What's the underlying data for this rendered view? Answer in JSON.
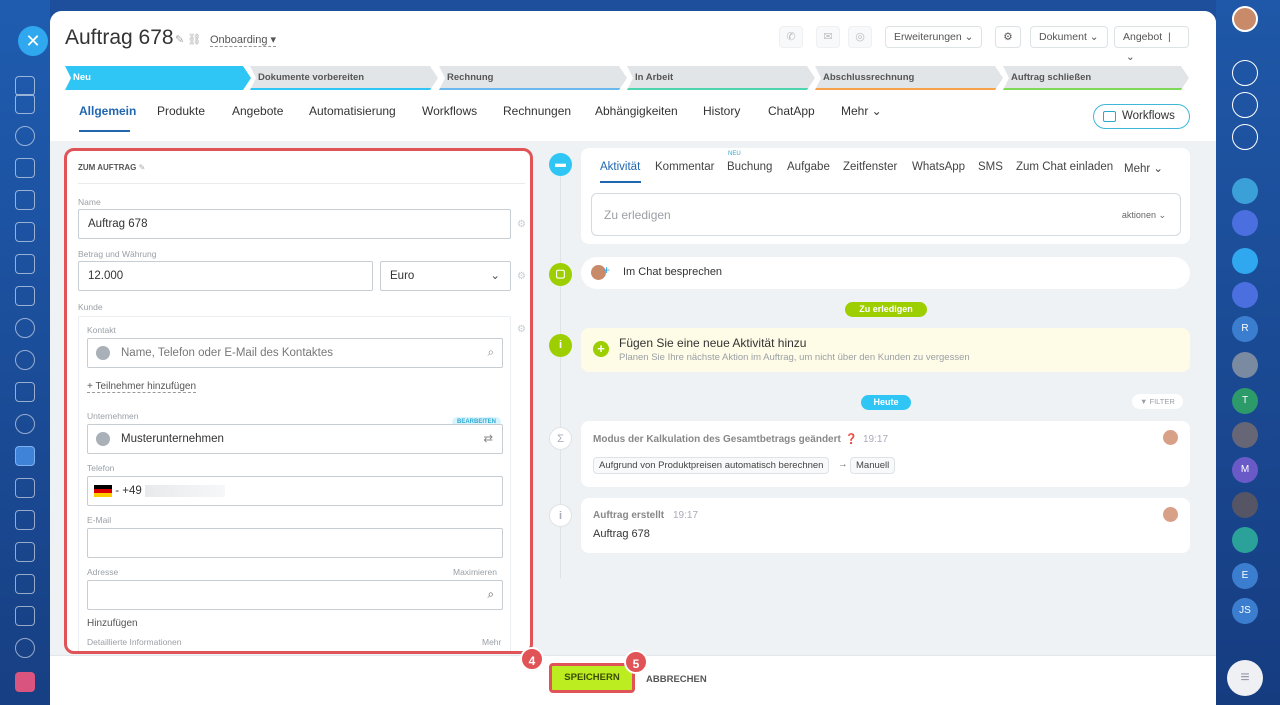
{
  "header": {
    "title": "Auftrag 678",
    "category": "Onboarding"
  },
  "top_buttons": {
    "extensions": "Erweiterungen",
    "document": "Dokument",
    "offer": "Angebot"
  },
  "stages": [
    "Neu",
    "Dokumente vorbereiten",
    "Rechnung",
    "In Arbeit",
    "Abschlussrechnung",
    "Auftrag schließen"
  ],
  "tabs": [
    "Allgemein",
    "Produkte",
    "Angebote",
    "Automatisierung",
    "Workflows",
    "Rechnungen",
    "Abhängigkeiten",
    "History",
    "ChatApp",
    "Mehr"
  ],
  "workflows_button": "Workflows",
  "form": {
    "section_title": "ZUM AUFTRAG",
    "name_label": "Name",
    "name_value": "Auftrag 678",
    "amount_label": "Betrag und Währung",
    "amount_value": "12.000",
    "currency_value": "Euro",
    "client_label": "Kunde",
    "contact_label": "Kontakt",
    "contact_placeholder": "Name, Telefon oder E-Mail des Kontaktes",
    "add_participant": "+ Teilnehmer hinzufügen",
    "company_label": "Unternehmen",
    "company_value": "Musterunternehmen",
    "edit_badge": "BEARBEITEN",
    "phone_label": "Telefon",
    "phone_prefix": "- +49",
    "email_label": "E-Mail",
    "address_label": "Adresse",
    "maximize": "Maximieren",
    "add": "Hinzufügen",
    "details_label": "Detaillierte Informationen",
    "more": "Mehr"
  },
  "activity": {
    "tabs": [
      "Aktivität",
      "Kommentar",
      "Buchung",
      "Aufgabe",
      "Zeitfenster",
      "WhatsApp",
      "SMS",
      "Zum Chat einladen",
      "Mehr"
    ],
    "new_badge": "NEU",
    "todo_placeholder": "Zu erledigen",
    "actions": "aktionen",
    "chat_discuss": "Im Chat besprechen",
    "todo_pill": "Zu erledigen",
    "add_activity_title": "Fügen Sie eine neue Aktivität hinzu",
    "add_activity_desc": "Planen Sie Ihre nächste Aktion im Auftrag, um nicht über den Kunden zu vergessen",
    "today_pill": "Heute",
    "filter": "FILTER",
    "event1_title": "Modus der Kalkulation des Gesamtbetrags geändert",
    "event1_time": "19:17",
    "event1_from": "Aufgrund von Produktpreisen automatisch berechnen",
    "event1_arrow": "→",
    "event1_to": "Manuell",
    "event2_title": "Auftrag erstellt",
    "event2_time": "19:17",
    "event2_text": "Auftrag 678"
  },
  "footer": {
    "save": "SPEICHERN",
    "cancel": "ABBRECHEN",
    "badge4": "4",
    "badge5": "5"
  },
  "right_sidebar": {
    "initials": [
      "R",
      "T",
      "M",
      "E",
      "JS"
    ]
  },
  "colors": {
    "accent": "#2067b0",
    "save": "#bbed21",
    "highlight": "#e05458",
    "stage_new": "#2fc6f6"
  }
}
